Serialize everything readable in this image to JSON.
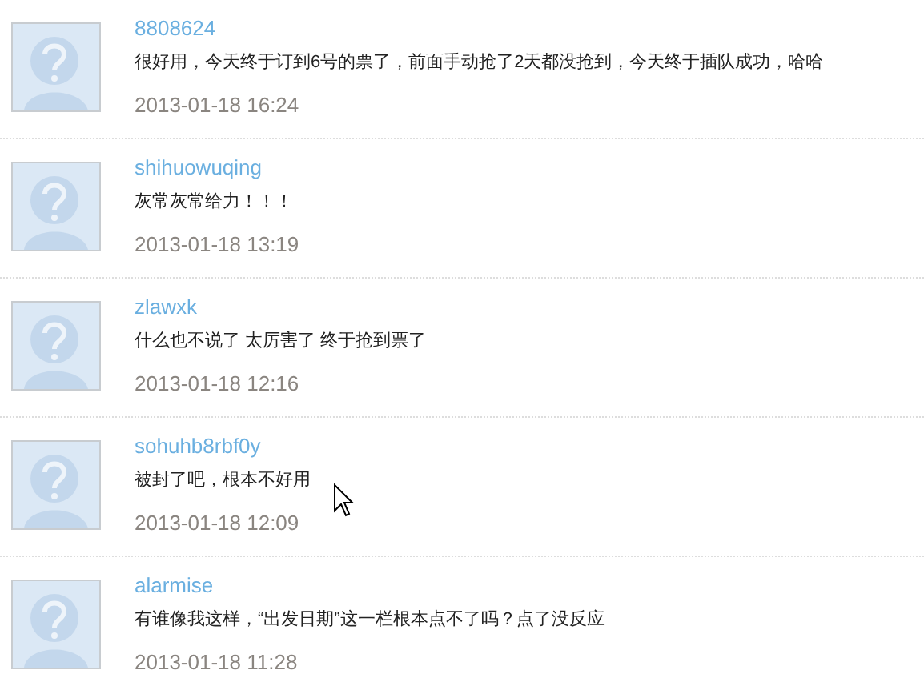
{
  "comments": [
    {
      "user": "8808624",
      "text": "很好用，今天终于订到6号的票了，前面手动抢了2天都没抢到，今天终于插队成功，哈哈",
      "time": "2013-01-18 16:24"
    },
    {
      "user": "shihuowuqing",
      "text": "灰常灰常给力！！！",
      "time": "2013-01-18 13:19"
    },
    {
      "user": "zlawxk",
      "text": "什么也不说了 太厉害了 终于抢到票了",
      "time": "2013-01-18 12:16"
    },
    {
      "user": "sohuhb8rbf0y",
      "text": "被封了吧，根本不好用",
      "time": "2013-01-18 12:09"
    },
    {
      "user": "alarmise",
      "text": "有谁像我这样，“出发日期”这一栏根本点不了吗？点了没反应",
      "time": "2013-01-18 11:28"
    }
  ]
}
